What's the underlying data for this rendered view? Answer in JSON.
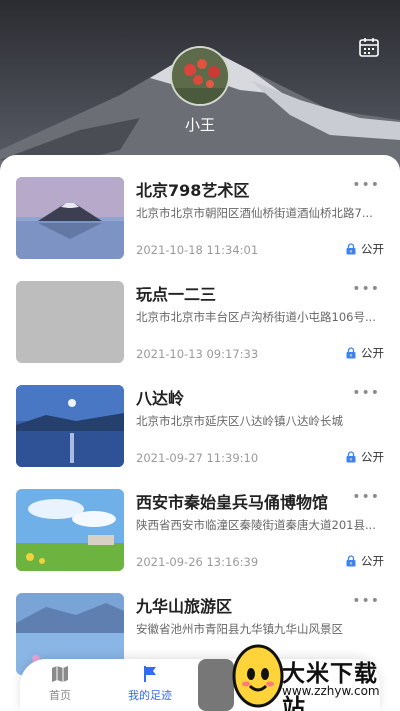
{
  "profile": {
    "name": "小王"
  },
  "items": [
    {
      "title": "北京798艺术区",
      "address": "北京市北京市朝阳区酒仙桥街道酒仙桥北路7...",
      "date": "2021-10-18 11:34:01",
      "visibility": "公开"
    },
    {
      "title": "玩点一二三",
      "address": "北京市北京市丰台区卢沟桥街道小屯路106号...",
      "date": "2021-10-13 09:17:33",
      "visibility": "公开"
    },
    {
      "title": "八达岭",
      "address": "北京市北京市延庆区八达岭镇八达岭长城",
      "date": "2021-09-27 11:39:10",
      "visibility": "公开"
    },
    {
      "title": "西安市秦始皇兵马俑博物馆",
      "address": "陕西省西安市临潼区秦陵街道秦唐大道201县...",
      "date": "2021-09-26 13:16:39",
      "visibility": "公开"
    },
    {
      "title": "九华山旅游区",
      "address": "安徽省池州市青阳县九华镇九华山风景区",
      "date": "",
      "visibility": ""
    }
  ],
  "more_label": "•••",
  "tabs": [
    {
      "label": "首页"
    },
    {
      "label": "我的足迹"
    }
  ],
  "watermark": {
    "title": "大米下载站",
    "url": "www.zzhyw.com"
  },
  "colors": {
    "accent": "#2f6df5",
    "lock": "#3b82f6"
  }
}
